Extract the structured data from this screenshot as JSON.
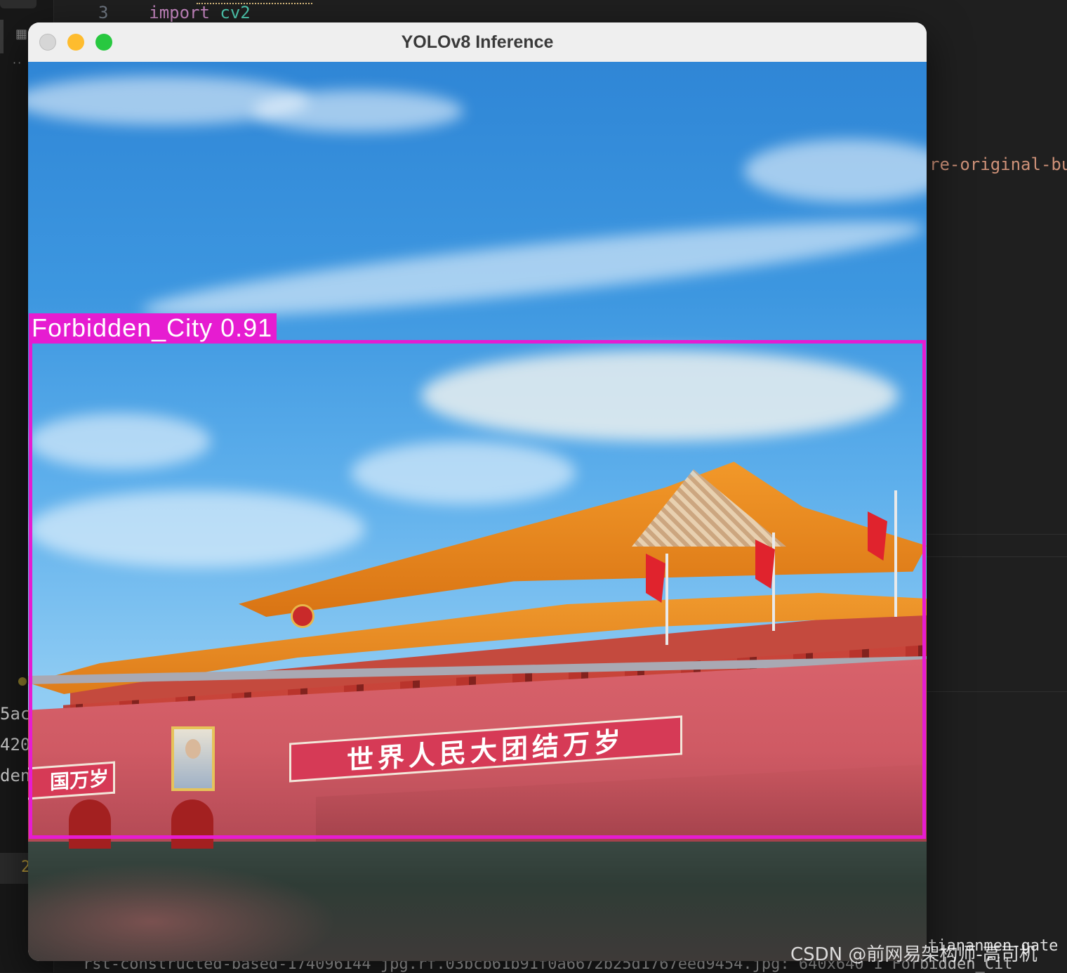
{
  "editor": {
    "line_number": "3",
    "code_keyword": "import",
    "code_module": "cv2",
    "right_fragment": "re-original-bu",
    "left_fragments": [
      "5ac",
      "420",
      "den-"
    ],
    "left_line_number": "2",
    "bottom_output": "rst-constructed-based-174096144 jpg.rf.03bcb61b91f0a6672b25d1767eed9454.jpg: 640x640 1 Forbidden_Cit",
    "bottom_right_output": "tiananmen-gate",
    "watermark": "CSDN @前网易架构师-高司机"
  },
  "window": {
    "title": "YOLOv8 Inference",
    "controls": [
      "close",
      "minimize",
      "zoom"
    ]
  },
  "detection": {
    "label": "Forbidden_City 0.91",
    "class": "Forbidden_City",
    "confidence": 0.91,
    "color": "#e61cd1"
  },
  "scene": {
    "banner_text": "世界人民大团结万岁",
    "banner_left_text": "国万岁"
  }
}
